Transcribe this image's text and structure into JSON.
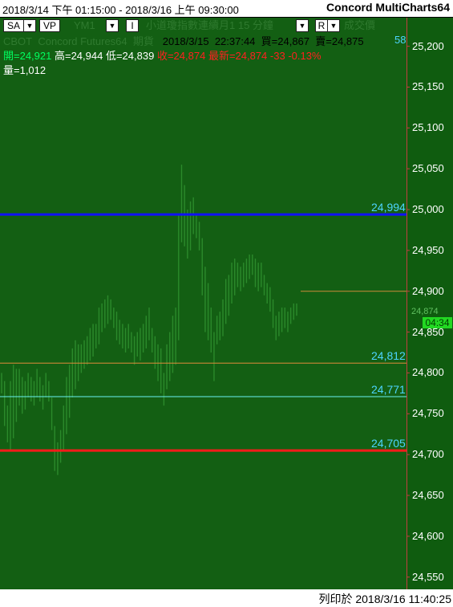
{
  "title_bar": {
    "range": "2018/3/14 下午 01:15:00 - 2018/3/16 上午 09:30:00",
    "app_name": "Concord MultiCharts64"
  },
  "toolbar": {
    "sa_button": "SA",
    "vp_button": "VP",
    "symbol": "YM1",
    "i_button": "I",
    "symbol_desc": "小道瓊指數連續月1 15 分鐘",
    "r_button": "R",
    "volume_label": "成交價"
  },
  "info_line1": {
    "exchange": "CBOT",
    "source": "Concord Futures64",
    "type": "期貨",
    "date": "2018/3/15",
    "time": "22:37:44",
    "bid": "買=24,867",
    "ask": "賣=24,875",
    "right_value": "58"
  },
  "info_line2": {
    "open": "開=24,921",
    "high": "高=24,944",
    "low": "低=24,839",
    "close": "收=24,874",
    "last": "最新=24,874",
    "change": "-33",
    "pct": "-0.13%"
  },
  "info_line3": {
    "volume": "量=1,012"
  },
  "y_axis": {
    "labels": [
      "25,200",
      "25,150",
      "25,100",
      "25,050",
      "25,000",
      "24,950",
      "24,900",
      "24,850",
      "24,800",
      "24,750",
      "24,700",
      "24,650",
      "24,600",
      "24,550"
    ],
    "range": [
      24535,
      25235
    ]
  },
  "current_price": {
    "value": "24,874",
    "timer": "04:34"
  },
  "h_lines": [
    {
      "value": 24994,
      "label": "24,994",
      "color": "#1010ff",
      "label_color": "#4dd4ff"
    },
    {
      "value": 24812,
      "label": "24,812",
      "color": "#e08a3a",
      "label_color": "#4dd4ff"
    },
    {
      "value": 24771,
      "label": "24,771",
      "color": "#6af0f0",
      "label_color": "#4dd4ff"
    },
    {
      "value": 24705,
      "label": "24,705",
      "color": "#ff1a1a",
      "label_color": "#4dd4ff"
    },
    {
      "value": 24900,
      "label": "",
      "color": "#d08a3a",
      "label_color": ""
    }
  ],
  "footer": {
    "printed_at": "列印於 2018/3/16 11:40:25"
  },
  "colors": {
    "background": "#135f13",
    "bars": "#2b8a2b",
    "axis_line": "#c04040",
    "timer_bg": "#22d822"
  },
  "chart_data": {
    "type": "bar",
    "symbol": "YM1",
    "series": [
      {
        "values": [
          [
            24775,
            24800
          ],
          [
            24735,
            24790
          ],
          [
            24715,
            24760
          ],
          [
            24705,
            24790
          ],
          [
            24720,
            24810
          ],
          [
            24740,
            24805
          ],
          [
            24760,
            24805
          ],
          [
            24750,
            24795
          ],
          [
            24755,
            24790
          ],
          [
            24770,
            24800
          ],
          [
            24765,
            24795
          ],
          [
            24760,
            24790
          ],
          [
            24770,
            24805
          ],
          [
            24765,
            24795
          ],
          [
            24755,
            24785
          ],
          [
            24770,
            24800
          ],
          [
            24765,
            24790
          ],
          [
            24730,
            24770
          ],
          [
            24680,
            24735
          ],
          [
            24675,
            24715
          ],
          [
            24690,
            24730
          ],
          [
            24705,
            24760
          ],
          [
            24725,
            24795
          ],
          [
            24745,
            24810
          ],
          [
            24770,
            24830
          ],
          [
            24780,
            24840
          ],
          [
            24790,
            24835
          ],
          [
            24800,
            24835
          ],
          [
            24805,
            24840
          ],
          [
            24810,
            24845
          ],
          [
            24815,
            24855
          ],
          [
            24820,
            24860
          ],
          [
            24830,
            24860
          ],
          [
            24835,
            24880
          ],
          [
            24850,
            24885
          ],
          [
            24855,
            24890
          ],
          [
            24860,
            24895
          ],
          [
            24865,
            24890
          ],
          [
            24855,
            24880
          ],
          [
            24840,
            24875
          ],
          [
            24835,
            24865
          ],
          [
            24830,
            24860
          ],
          [
            24825,
            24855
          ],
          [
            24830,
            24860
          ],
          [
            24825,
            24850
          ],
          [
            24810,
            24845
          ],
          [
            24820,
            24850
          ],
          [
            24815,
            24855
          ],
          [
            24825,
            24860
          ],
          [
            24830,
            24870
          ],
          [
            24840,
            24880
          ],
          [
            24825,
            24855
          ],
          [
            24805,
            24845
          ],
          [
            24790,
            24835
          ],
          [
            24775,
            24830
          ],
          [
            24760,
            24800
          ],
          [
            24780,
            24835
          ],
          [
            24790,
            24850
          ],
          [
            24800,
            24870
          ],
          [
            24810,
            24880
          ],
          [
            24840,
            24995
          ],
          [
            24960,
            25055
          ],
          [
            24955,
            25030
          ],
          [
            24940,
            25000
          ],
          [
            24950,
            25010
          ],
          [
            24970,
            25015
          ],
          [
            24965,
            24995
          ],
          [
            24950,
            24985
          ],
          [
            24895,
            24965
          ],
          [
            24850,
            24930
          ],
          [
            24840,
            24910
          ],
          [
            24825,
            24880
          ],
          [
            24790,
            24850
          ],
          [
            24835,
            24870
          ],
          [
            24840,
            24875
          ],
          [
            24845,
            24890
          ],
          [
            24860,
            24915
          ],
          [
            24870,
            24920
          ],
          [
            24885,
            24935
          ],
          [
            24895,
            24940
          ],
          [
            24905,
            24935
          ],
          [
            24900,
            24930
          ],
          [
            24905,
            24935
          ],
          [
            24910,
            24940
          ],
          [
            24915,
            24945
          ],
          [
            24920,
            24945
          ],
          [
            24905,
            24940
          ],
          [
            24900,
            24935
          ],
          [
            24905,
            24935
          ],
          [
            24895,
            24920
          ],
          [
            24885,
            24910
          ],
          [
            24875,
            24905
          ],
          [
            24855,
            24890
          ],
          [
            24840,
            24870
          ],
          [
            24845,
            24875
          ],
          [
            24850,
            24880
          ],
          [
            24855,
            24880
          ],
          [
            24850,
            24875
          ],
          [
            24860,
            24880
          ],
          [
            24865,
            24885
          ],
          [
            24870,
            24885
          ]
        ]
      }
    ]
  }
}
